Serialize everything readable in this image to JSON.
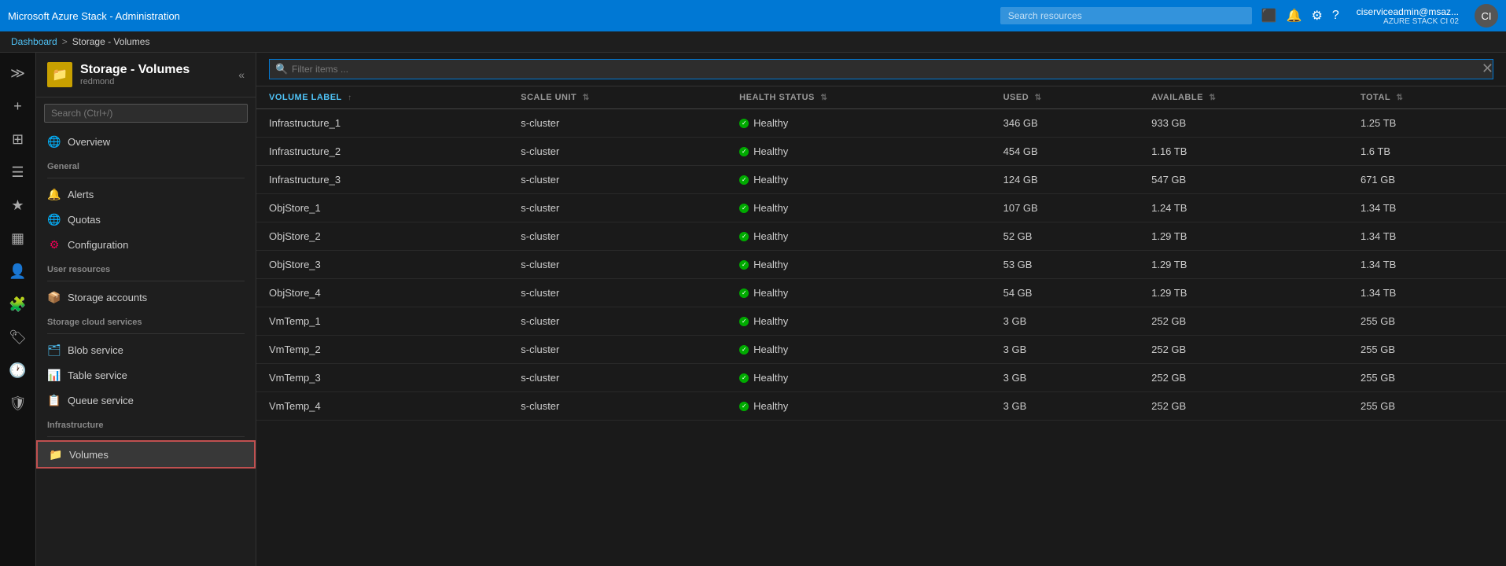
{
  "app": {
    "title": "Microsoft Azure Stack - Administration",
    "user": {
      "name": "ciserviceadmin@msaz...",
      "subtitle": "AZURE STACK CI 02"
    },
    "search_placeholder": "Search resources"
  },
  "breadcrumb": {
    "home": "Dashboard",
    "separator": ">",
    "current": "Storage - Volumes"
  },
  "sidebar": {
    "title": "Storage - Volumes",
    "subtitle": "redmond",
    "search_placeholder": "Search (Ctrl+/)",
    "nav_items": [
      {
        "id": "overview",
        "label": "Overview",
        "icon": "🌐",
        "section": null
      },
      {
        "id": "alerts",
        "label": "Alerts",
        "icon": "🔔",
        "section": "General"
      },
      {
        "id": "quotas",
        "label": "Quotas",
        "icon": "🌐",
        "section": null
      },
      {
        "id": "configuration",
        "label": "Configuration",
        "icon": "⚙",
        "section": null
      },
      {
        "id": "storage-accounts",
        "label": "Storage accounts",
        "icon": "📦",
        "section": "User resources"
      },
      {
        "id": "blob-service",
        "label": "Blob service",
        "icon": "🗂",
        "section": "Storage cloud services"
      },
      {
        "id": "table-service",
        "label": "Table service",
        "icon": "📊",
        "section": null
      },
      {
        "id": "queue-service",
        "label": "Queue service",
        "icon": "📋",
        "section": null
      },
      {
        "id": "volumes",
        "label": "Volumes",
        "icon": "📁",
        "section": "Infrastructure",
        "active": true
      }
    ]
  },
  "table": {
    "filter_placeholder": "Filter items ...",
    "columns": [
      {
        "key": "volume_label",
        "label": "VOLUME LABEL",
        "active": true
      },
      {
        "key": "scale_unit",
        "label": "SCALE UNIT"
      },
      {
        "key": "health_status",
        "label": "HEALTH STATUS"
      },
      {
        "key": "used",
        "label": "USED"
      },
      {
        "key": "available",
        "label": "AVAILABLE"
      },
      {
        "key": "total",
        "label": "TOTAL"
      }
    ],
    "rows": [
      {
        "volume_label": "Infrastructure_1",
        "scale_unit": "s-cluster",
        "health_status": "Healthy",
        "used": "346 GB",
        "available": "933 GB",
        "total": "1.25 TB"
      },
      {
        "volume_label": "Infrastructure_2",
        "scale_unit": "s-cluster",
        "health_status": "Healthy",
        "used": "454 GB",
        "available": "1.16 TB",
        "total": "1.6 TB"
      },
      {
        "volume_label": "Infrastructure_3",
        "scale_unit": "s-cluster",
        "health_status": "Healthy",
        "used": "124 GB",
        "available": "547 GB",
        "total": "671 GB"
      },
      {
        "volume_label": "ObjStore_1",
        "scale_unit": "s-cluster",
        "health_status": "Healthy",
        "used": "107 GB",
        "available": "1.24 TB",
        "total": "1.34 TB"
      },
      {
        "volume_label": "ObjStore_2",
        "scale_unit": "s-cluster",
        "health_status": "Healthy",
        "used": "52 GB",
        "available": "1.29 TB",
        "total": "1.34 TB"
      },
      {
        "volume_label": "ObjStore_3",
        "scale_unit": "s-cluster",
        "health_status": "Healthy",
        "used": "53 GB",
        "available": "1.29 TB",
        "total": "1.34 TB"
      },
      {
        "volume_label": "ObjStore_4",
        "scale_unit": "s-cluster",
        "health_status": "Healthy",
        "used": "54 GB",
        "available": "1.29 TB",
        "total": "1.34 TB"
      },
      {
        "volume_label": "VmTemp_1",
        "scale_unit": "s-cluster",
        "health_status": "Healthy",
        "used": "3 GB",
        "available": "252 GB",
        "total": "255 GB"
      },
      {
        "volume_label": "VmTemp_2",
        "scale_unit": "s-cluster",
        "health_status": "Healthy",
        "used": "3 GB",
        "available": "252 GB",
        "total": "255 GB"
      },
      {
        "volume_label": "VmTemp_3",
        "scale_unit": "s-cluster",
        "health_status": "Healthy",
        "used": "3 GB",
        "available": "252 GB",
        "total": "255 GB"
      },
      {
        "volume_label": "VmTemp_4",
        "scale_unit": "s-cluster",
        "health_status": "Healthy",
        "used": "3 GB",
        "available": "252 GB",
        "total": "255 GB"
      }
    ]
  },
  "icons": {
    "search": "🔍",
    "bell": "🔔",
    "gear": "⚙",
    "question": "?",
    "close": "✕",
    "collapse": "«",
    "plus": "+",
    "dashboard": "⊞",
    "list": "☰",
    "star": "★",
    "grid": "⊞",
    "people": "👤",
    "puzzle": "🧩",
    "tag": "🏷",
    "clock": "🕐",
    "shield": "🛡",
    "up_arrow": "↑",
    "sort": "⇅"
  }
}
